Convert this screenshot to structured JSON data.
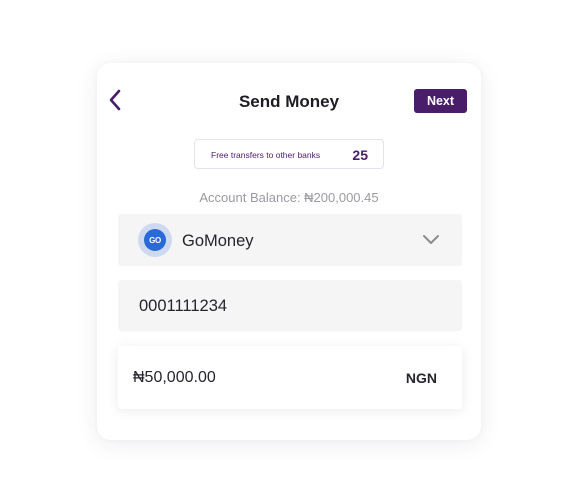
{
  "header": {
    "title": "Send Money",
    "next_label": "Next"
  },
  "free_transfers": {
    "label": "Free transfers to other banks",
    "count": "25"
  },
  "balance": {
    "text": "Account Balance: ₦200,000.45"
  },
  "bank": {
    "logo_text": "GO",
    "name": "GoMoney"
  },
  "account": {
    "number": "0001111234"
  },
  "amount": {
    "value": "₦50,000.00",
    "currency": "NGN"
  },
  "colors": {
    "brand": "#4a1d6b",
    "field_bg": "#f5f5f5",
    "muted_text": "#9a9aa2",
    "bank_logo": "#2a6ad6"
  },
  "icons": {
    "back": "chevron-left-icon",
    "dropdown": "chevron-down-icon"
  }
}
